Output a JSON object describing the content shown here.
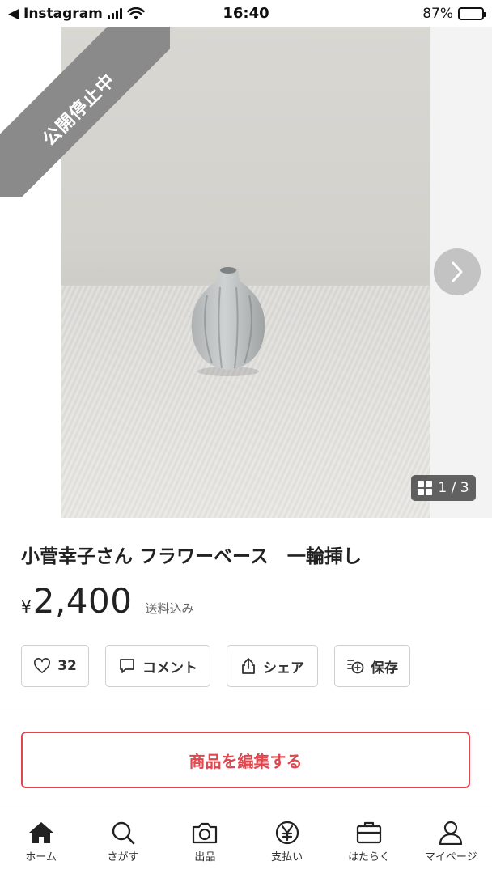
{
  "status_bar": {
    "back_app": "◀ Instagram",
    "time": "16:40",
    "battery_pct": "87%",
    "battery_level": 0.87
  },
  "gallery": {
    "ribbon": "公開停止中",
    "counter": "1 / 3",
    "current_index": 1,
    "total": 3
  },
  "product": {
    "title": "小菅幸子さん フラワーベース　一輪挿し",
    "price_symbol": "¥",
    "price": "2,400",
    "shipping": "送料込み"
  },
  "actions": {
    "like_count": "32",
    "comment_label": "コメント",
    "share_label": "シェア",
    "save_label": "保存"
  },
  "edit_button": "商品を編集する",
  "tabs": [
    {
      "label": "ホーム",
      "icon": "home-icon"
    },
    {
      "label": "さがす",
      "icon": "search-icon"
    },
    {
      "label": "出品",
      "icon": "camera-icon"
    },
    {
      "label": "支払い",
      "icon": "yen-icon"
    },
    {
      "label": "はたらく",
      "icon": "briefcase-icon"
    },
    {
      "label": "マイページ",
      "icon": "person-icon"
    }
  ],
  "colors": {
    "accent_red": "#e0464e",
    "ribbon_gray": "#8a8a8a"
  }
}
